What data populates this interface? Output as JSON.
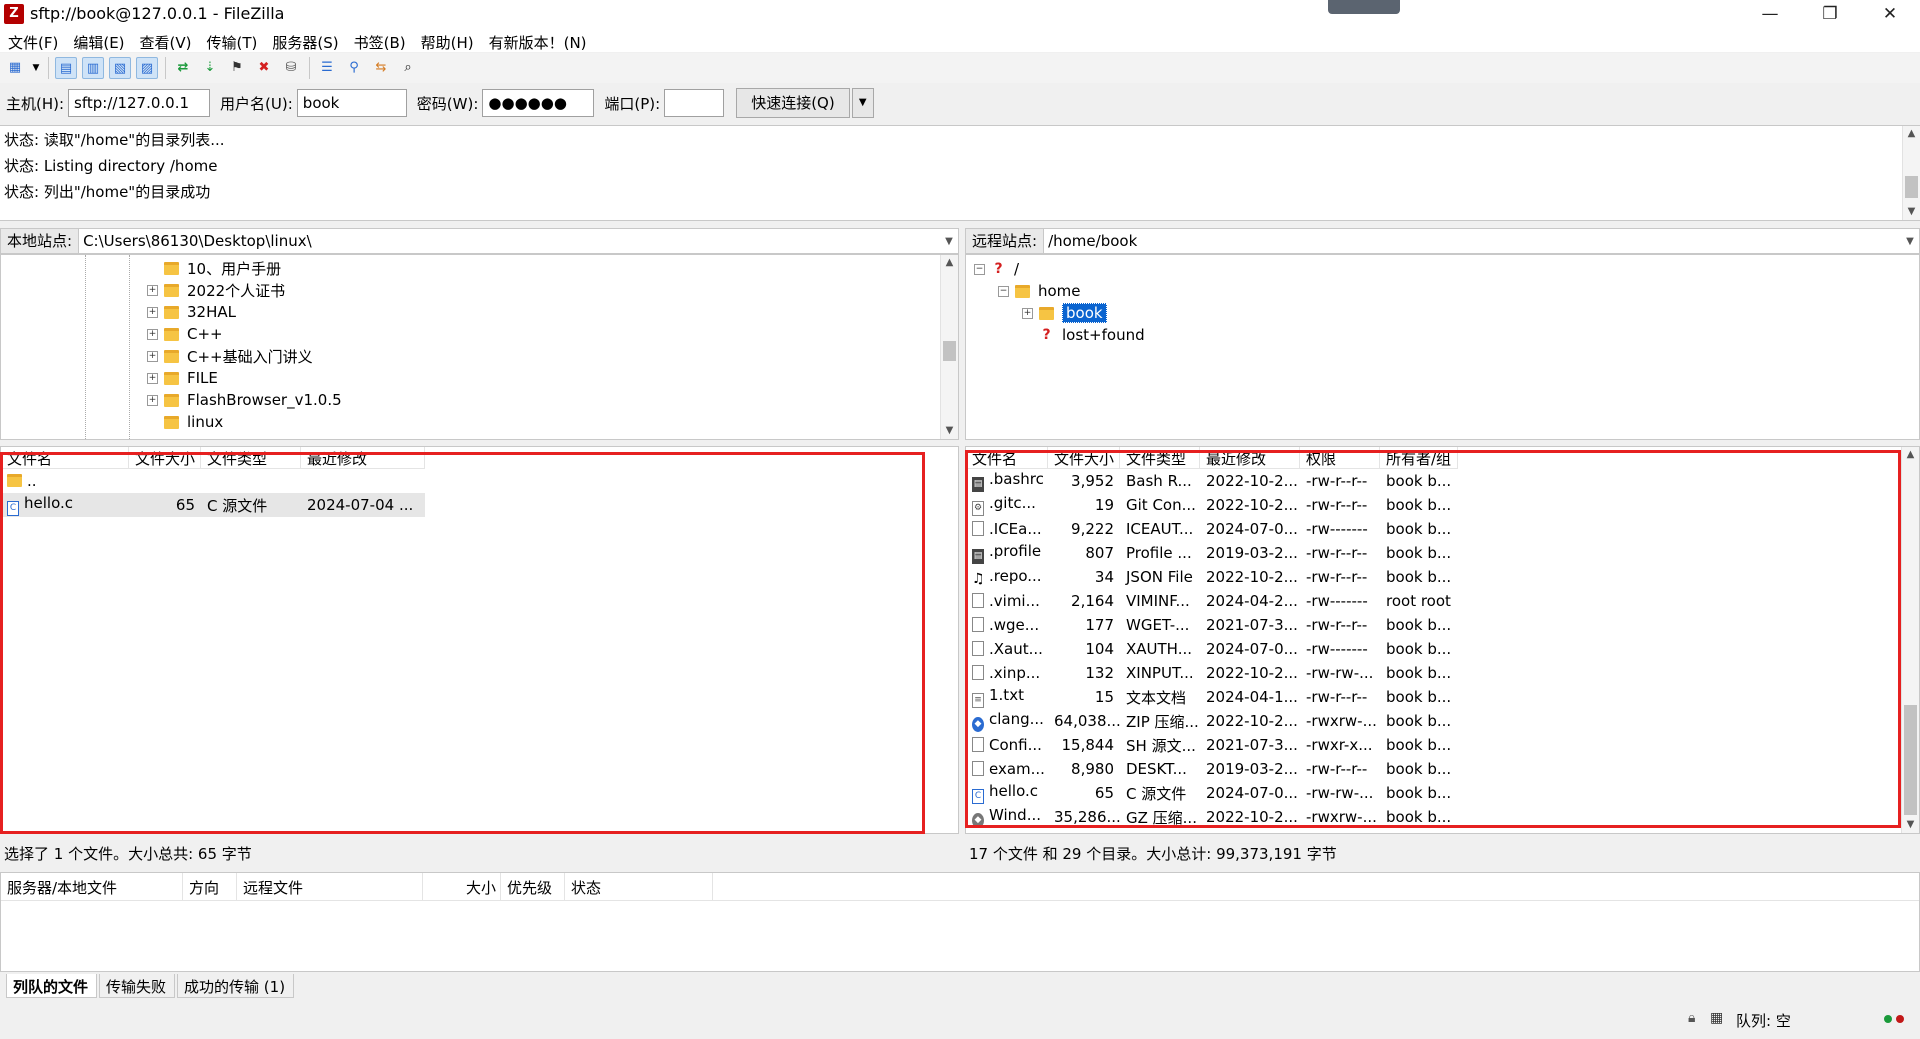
{
  "window": {
    "title": "sftp://book@127.0.0.1 - FileZilla",
    "app_icon_letter": "Z",
    "minimize": "—",
    "maximize": "❐",
    "close": "✕"
  },
  "menu": [
    "文件(F)",
    "编辑(E)",
    "查看(V)",
    "传输(T)",
    "服务器(S)",
    "书签(B)",
    "帮助(H)",
    "有新版本！(N)"
  ],
  "quickconnect": {
    "host_label": "主机(H):",
    "host_value": "sftp://127.0.0.1",
    "user_label": "用户名(U):",
    "user_value": "book",
    "pass_label": "密码(W):",
    "pass_value": "●●●●●●",
    "port_label": "端口(P):",
    "port_value": "",
    "connect_label": "快速连接(Q)",
    "dropdown": "▼"
  },
  "log": [
    "状态:  读取\"/home\"的目录列表...",
    "状态:  Listing directory /home",
    "状态:  列出\"/home\"的目录成功"
  ],
  "local": {
    "site_label": "本地站点:",
    "site_path": "C:\\Users\\86130\\Desktop\\linux\\",
    "tree": [
      {
        "label": "10、用户手册",
        "expandable": false
      },
      {
        "label": "2022个人证书",
        "expandable": true
      },
      {
        "label": "32HAL",
        "expandable": true
      },
      {
        "label": "C++",
        "expandable": true
      },
      {
        "label": "C++基础入门讲义",
        "expandable": true
      },
      {
        "label": "FILE",
        "expandable": true
      },
      {
        "label": "FlashBrowser_v1.0.5",
        "expandable": true
      },
      {
        "label": "linux",
        "expandable": false
      }
    ],
    "columns": [
      "文件名",
      "文件大小",
      "文件类型",
      "最近修改"
    ],
    "files": [
      {
        "name": "..",
        "size": "",
        "type": "",
        "modified": ""
      },
      {
        "name": "hello.c",
        "size": "65",
        "type": "C 源文件",
        "modified": "2024-07-04 ..."
      }
    ],
    "status": "选择了 1 个文件。大小总共: 65 字节"
  },
  "remote": {
    "site_label": "远程站点:",
    "site_path": "/home/book",
    "tree": [
      {
        "label": "/",
        "level": 0
      },
      {
        "label": "home",
        "level": 1
      },
      {
        "label": "book",
        "level": 2,
        "selected": true
      },
      {
        "label": "lost+found",
        "level": 2
      }
    ],
    "columns": [
      "文件名",
      "文件大小",
      "文件类型",
      "最近修改",
      "权限",
      "所有者/组"
    ],
    "files": [
      {
        "name": ".bashrc",
        "size": "3,952",
        "type": "Bash R...",
        "modified": "2022-10-2...",
        "perms": "-rw-r--r--",
        "owner": "book b..."
      },
      {
        "name": ".gitc...",
        "size": "19",
        "type": "Git Con...",
        "modified": "2022-10-2...",
        "perms": "-rw-r--r--",
        "owner": "book b..."
      },
      {
        "name": ".ICEa...",
        "size": "9,222",
        "type": "ICEAUT...",
        "modified": "2024-07-0...",
        "perms": "-rw-------",
        "owner": "book b..."
      },
      {
        "name": ".profile",
        "size": "807",
        "type": "Profile ...",
        "modified": "2019-03-2...",
        "perms": "-rw-r--r--",
        "owner": "book b..."
      },
      {
        "name": ".repo...",
        "size": "34",
        "type": "JSON File",
        "modified": "2022-10-2...",
        "perms": "-rw-r--r--",
        "owner": "book b..."
      },
      {
        "name": ".vimi...",
        "size": "2,164",
        "type": "VIMINF...",
        "modified": "2024-04-2...",
        "perms": "-rw-------",
        "owner": "root root"
      },
      {
        "name": ".wge...",
        "size": "177",
        "type": "WGET-...",
        "modified": "2021-07-3...",
        "perms": "-rw-r--r--",
        "owner": "book b..."
      },
      {
        "name": ".Xaut...",
        "size": "104",
        "type": "XAUTH...",
        "modified": "2024-07-0...",
        "perms": "-rw-------",
        "owner": "book b..."
      },
      {
        "name": ".xinp...",
        "size": "132",
        "type": "XINPUT...",
        "modified": "2022-10-2...",
        "perms": "-rw-rw-...",
        "owner": "book b..."
      },
      {
        "name": "1.txt",
        "size": "15",
        "type": "文本文档",
        "modified": "2024-04-1...",
        "perms": "-rw-r--r--",
        "owner": "book b..."
      },
      {
        "name": "clang...",
        "size": "64,038...",
        "type": "ZIP 压缩...",
        "modified": "2022-10-2...",
        "perms": "-rwxrw-...",
        "owner": "book b..."
      },
      {
        "name": "Confi...",
        "size": "15,844",
        "type": "SH 源文...",
        "modified": "2021-07-3...",
        "perms": "-rwxr-x...",
        "owner": "book b..."
      },
      {
        "name": "exam...",
        "size": "8,980",
        "type": "DESKT...",
        "modified": "2019-03-2...",
        "perms": "-rw-r--r--",
        "owner": "book b..."
      },
      {
        "name": "hello.c",
        "size": "65",
        "type": "C 源文件",
        "modified": "2024-07-0...",
        "perms": "-rw-rw-...",
        "owner": "book b..."
      },
      {
        "name": "Wind...",
        "size": "35,286...",
        "type": "GZ 压缩...",
        "modified": "2022-10-2...",
        "perms": "-rwxrw-...",
        "owner": "book b..."
      }
    ],
    "status": "17 个文件 和 29 个目录。大小总计: 99,373,191 字节"
  },
  "queue": {
    "columns": [
      "服务器/本地文件",
      "方向",
      "远程文件",
      "大小",
      "优先级",
      "状态"
    ],
    "tabs": [
      "列队的文件",
      "传输失败",
      "成功的传输 (1)"
    ]
  },
  "footer": {
    "queue_status": "队列: 空"
  },
  "colors": {
    "highlight_box": "#e62020",
    "selection": "#0a64d0"
  }
}
